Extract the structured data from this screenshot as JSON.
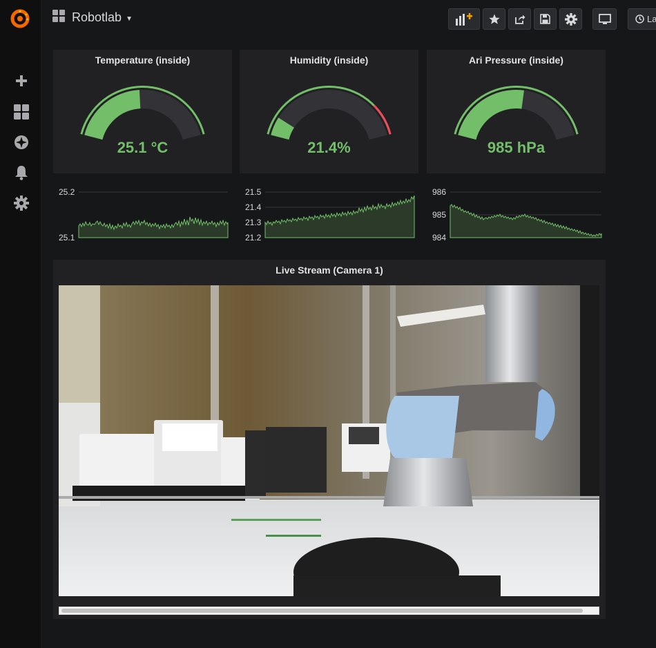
{
  "app": {
    "dashboard_title": "Robotlab",
    "brand_color": "#f46800"
  },
  "sidebar": {
    "items": [
      {
        "icon": "plus-icon",
        "label": "Create"
      },
      {
        "icon": "dashboards-icon",
        "label": "Dashboards"
      },
      {
        "icon": "explore-icon",
        "label": "Explore"
      },
      {
        "icon": "bell-icon",
        "label": "Alerting"
      },
      {
        "icon": "gear-icon",
        "label": "Configuration"
      }
    ]
  },
  "toolbar": {
    "buttons": [
      "add-panel-icon",
      "star-icon",
      "share-icon",
      "save-icon",
      "settings-icon",
      "tv-mode-icon"
    ],
    "time_picker_label": "La"
  },
  "gauges": [
    {
      "title": "Temperature (inside)",
      "display": "25.1 °C",
      "value_fraction": 0.48,
      "color": "#73bf69"
    },
    {
      "title": "Humidity (inside)",
      "display": "21.4%",
      "value_fraction": 0.12,
      "color": "#73bf69",
      "threshold_color": "#f2495c"
    },
    {
      "title": "Ari Pressure (inside)",
      "display": "985 hPa",
      "value_fraction": 0.55,
      "color": "#73bf69"
    }
  ],
  "sparklines": [
    {
      "ticks": [
        "25.2",
        "25.1"
      ],
      "ymin": 25.1,
      "ymax": 25.2
    },
    {
      "ticks": [
        "21.5",
        "21.4",
        "21.3",
        "21.2"
      ],
      "ymin": 21.2,
      "ymax": 21.5
    },
    {
      "ticks": [
        "986",
        "985",
        "984"
      ],
      "ymin": 984,
      "ymax": 986
    }
  ],
  "stream": {
    "title": "Live Stream (Camera 1)"
  }
}
